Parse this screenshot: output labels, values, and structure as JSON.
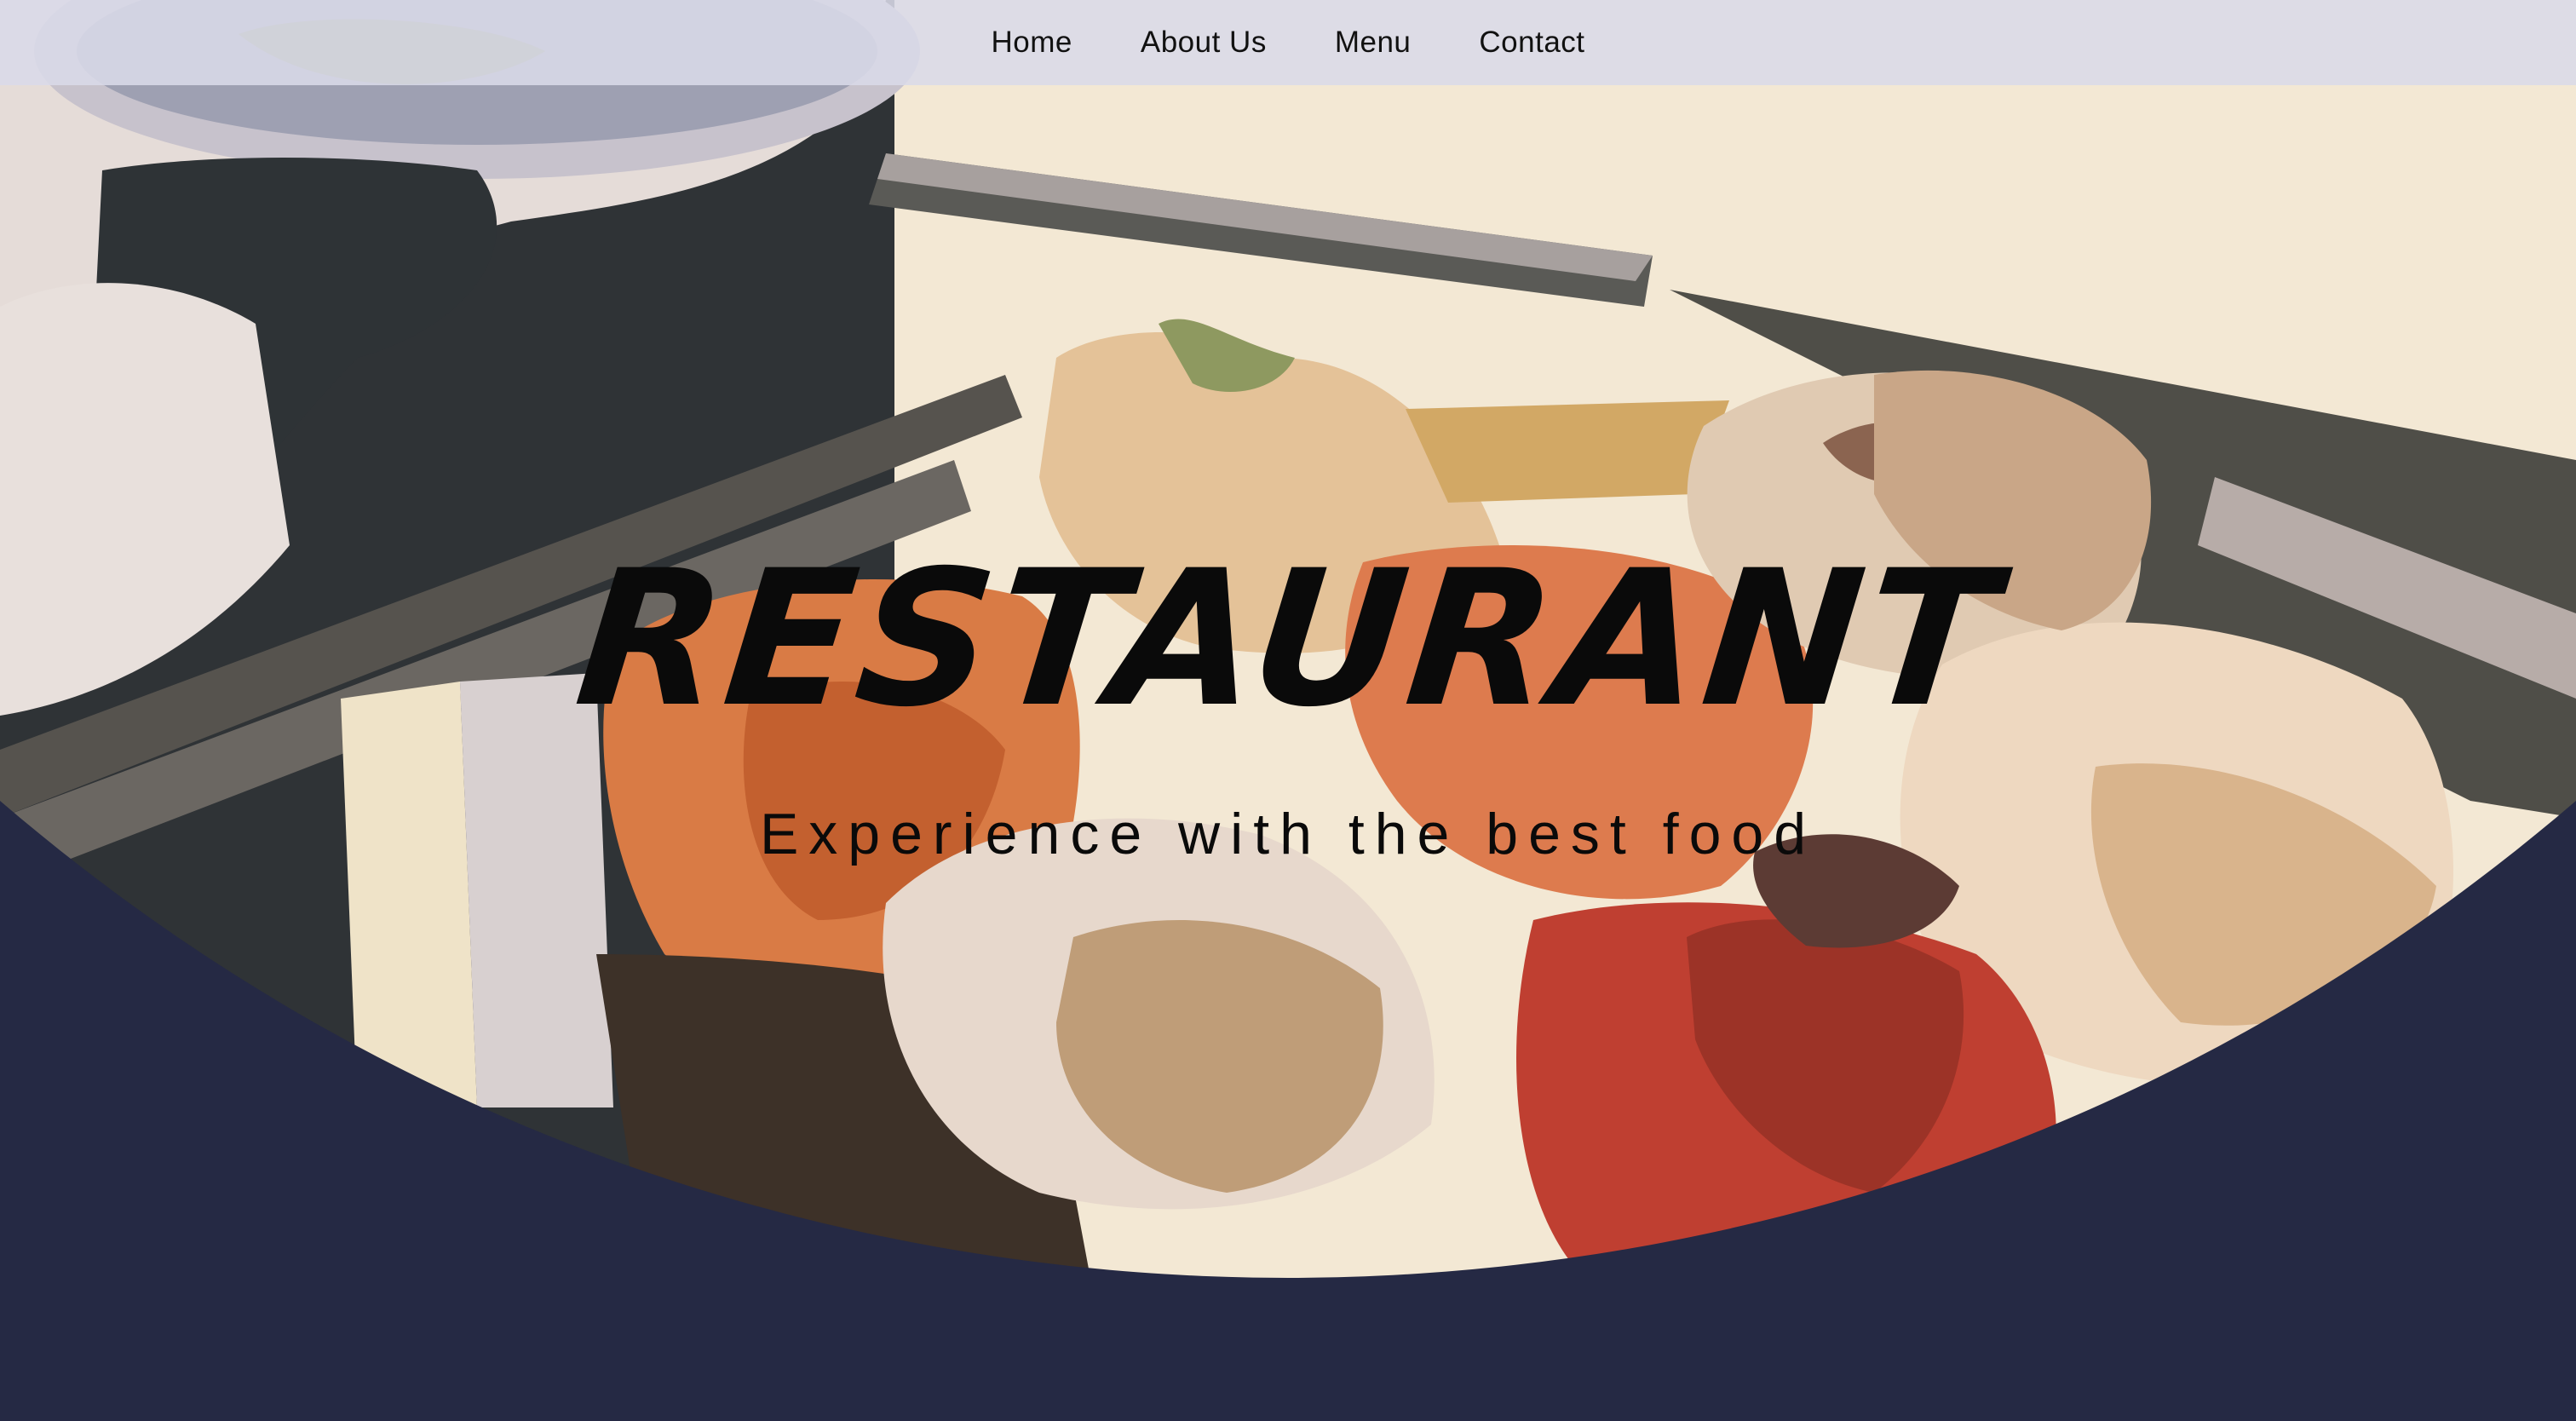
{
  "nav": {
    "items": [
      {
        "label": "Home"
      },
      {
        "label": "About Us"
      },
      {
        "label": "Menu"
      },
      {
        "label": "Contact"
      }
    ]
  },
  "hero": {
    "title": "RESTAURANT",
    "tagline": "Experience with the best food",
    "image_icon": "food-illustration-icon"
  },
  "colors": {
    "nav_background": "#dadae8",
    "footer_curve": "#252944",
    "cream_background": "#f3e8d4",
    "text": "#0a0a0a"
  }
}
